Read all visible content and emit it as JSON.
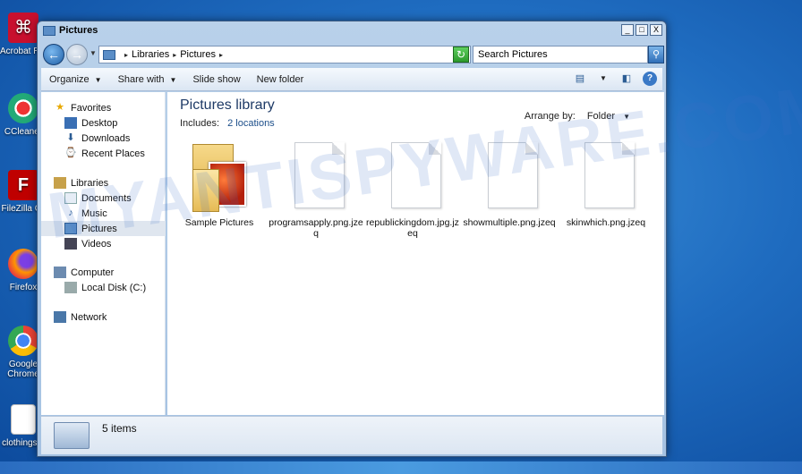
{
  "desktop": {
    "icons": [
      {
        "label": "Acrobat Reader D",
        "name": "acrobat-reader-icon"
      },
      {
        "label": "CCleaner",
        "name": "ccleaner-icon"
      },
      {
        "label": "FileZilla Cli",
        "name": "filezilla-icon"
      },
      {
        "label": "Firefox",
        "name": "firefox-icon"
      },
      {
        "label": "Google Chrome",
        "name": "chrome-icon"
      },
      {
        "label": "clothingsto",
        "name": "text-file-icon"
      }
    ],
    "watermark": "MYANTISPYWARE.COM"
  },
  "window": {
    "title": "Pictures",
    "caption_buttons": [
      "_",
      "□",
      "X"
    ]
  },
  "address": {
    "crumbs": [
      "Libraries",
      "Pictures"
    ],
    "search_placeholder": "Search Pictures"
  },
  "toolbar": {
    "organize": "Organize",
    "share_with": "Share with",
    "slide_show": "Slide show",
    "new_folder": "New folder"
  },
  "nav": {
    "favorites": "Favorites",
    "desktop": "Desktop",
    "downloads": "Downloads",
    "recent_places": "Recent Places",
    "libraries": "Libraries",
    "documents": "Documents",
    "music": "Music",
    "pictures": "Pictures",
    "videos": "Videos",
    "computer": "Computer",
    "local_disk": "Local Disk (C:)",
    "network": "Network"
  },
  "content": {
    "title": "Pictures library",
    "includes_label": "Includes:",
    "includes_value": "2 locations",
    "arrange_label": "Arrange by:",
    "arrange_value": "Folder",
    "files": [
      {
        "name": "Sample Pictures",
        "type": "folder"
      },
      {
        "name": "programsapply.png.jzeq",
        "type": "file"
      },
      {
        "name": "republickingdom.jpg.jzeq",
        "type": "file"
      },
      {
        "name": "showmultiple.png.jzeq",
        "type": "file"
      },
      {
        "name": "skinwhich.png.jzeq",
        "type": "file"
      }
    ]
  },
  "details": {
    "count": "5 items"
  }
}
